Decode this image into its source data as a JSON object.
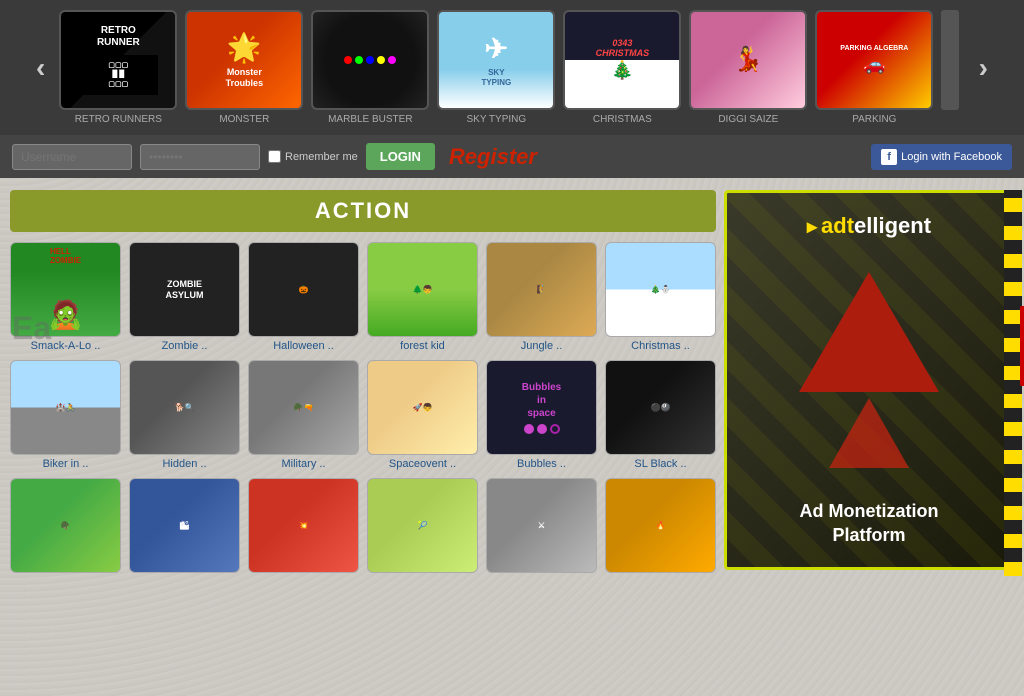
{
  "carousel": {
    "items": [
      {
        "label": "RETRO RUNNERS",
        "thumb": "retro"
      },
      {
        "label": "MONSTER",
        "thumb": "monster"
      },
      {
        "label": "MARBLE BUSTER",
        "thumb": "marble"
      },
      {
        "label": "SKY TYPING",
        "thumb": "sky"
      },
      {
        "label": "CHRISTMAS",
        "thumb": "christmas"
      },
      {
        "label": "DIGGI SAIZE",
        "thumb": "diggi"
      },
      {
        "label": "PARKING",
        "thumb": "parking"
      }
    ],
    "prev_label": "‹",
    "next_label": "›"
  },
  "login": {
    "username_placeholder": "Username",
    "password_placeholder": "••••••••",
    "remember_label": "Remember me",
    "login_button": "LOGIN",
    "register_link": "Register",
    "fb_button": "Login with Facebook"
  },
  "action_section": {
    "title": "ACTION"
  },
  "games_row1": [
    {
      "label": "Smack-A-Lo ..",
      "thumb": "smack"
    },
    {
      "label": "Zombie ..",
      "thumb": "zombie"
    },
    {
      "label": "Halloween ..",
      "thumb": "halloween"
    },
    {
      "label": "forest kid",
      "thumb": "forest"
    },
    {
      "label": "Jungle ..",
      "thumb": "jungle"
    },
    {
      "label": "Christmas ..",
      "thumb": "christmas_game"
    }
  ],
  "games_row2": [
    {
      "label": "Biker in ..",
      "thumb": "biker"
    },
    {
      "label": "Hidden ..",
      "thumb": "hidden"
    },
    {
      "label": "Military ..",
      "thumb": "military"
    },
    {
      "label": "Spaceovent ..",
      "thumb": "spacevent"
    },
    {
      "label": "Bubbles ..",
      "thumb": "bubbles"
    },
    {
      "label": "SL Black ..",
      "thumb": "slblack"
    }
  ],
  "games_row3": [
    {
      "label": "",
      "thumb": "row3a"
    },
    {
      "label": "",
      "thumb": "row3b"
    },
    {
      "label": "",
      "thumb": "row3c"
    },
    {
      "label": "",
      "thumb": "row3d"
    },
    {
      "label": "",
      "thumb": "row3e"
    },
    {
      "label": "",
      "thumb": "row3f"
    }
  ],
  "ad": {
    "logo_icon": "▸",
    "logo_text_1": "adt",
    "logo_text_2": "elligent",
    "bottom_line1": "Ad Monetization",
    "bottom_line2": "Platform"
  }
}
